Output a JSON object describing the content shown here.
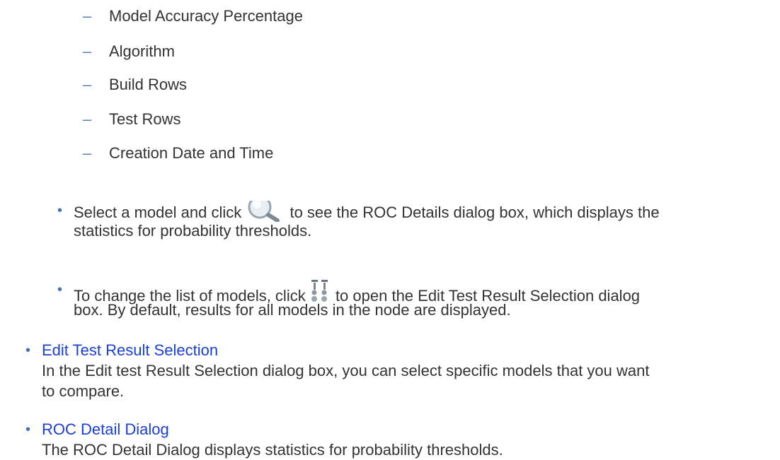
{
  "sub_list": [
    "Model Accuracy Percentage",
    "Algorithm",
    "Build Rows",
    "Test Rows",
    "Creation Date and Time"
  ],
  "bullet_roc": {
    "before": "Select a model and click ",
    "icon": "magnifier-icon",
    "after": " to see the ROC Details dialog box, which displays the",
    "line2": "statistics for probability thresholds."
  },
  "bullet_edit": {
    "before": "To change the list of models, click ",
    "icon": "edit-selection-icon",
    "after": " to open the Edit Test Result Selection dialog",
    "line2": "box. By default, results for all models in the node are displayed."
  },
  "links": [
    {
      "title": "Edit Test Result Selection",
      "line1": "In the Edit test Result Selection dialog box, you can select specific models that you want",
      "line2": "to compare."
    },
    {
      "title": "ROC Detail Dialog",
      "line1": "The ROC Detail Dialog displays statistics for probability thresholds."
    }
  ],
  "colors": {
    "link": "#1a3fd6",
    "bullet": "#4a6fb5",
    "text": "#333333"
  }
}
